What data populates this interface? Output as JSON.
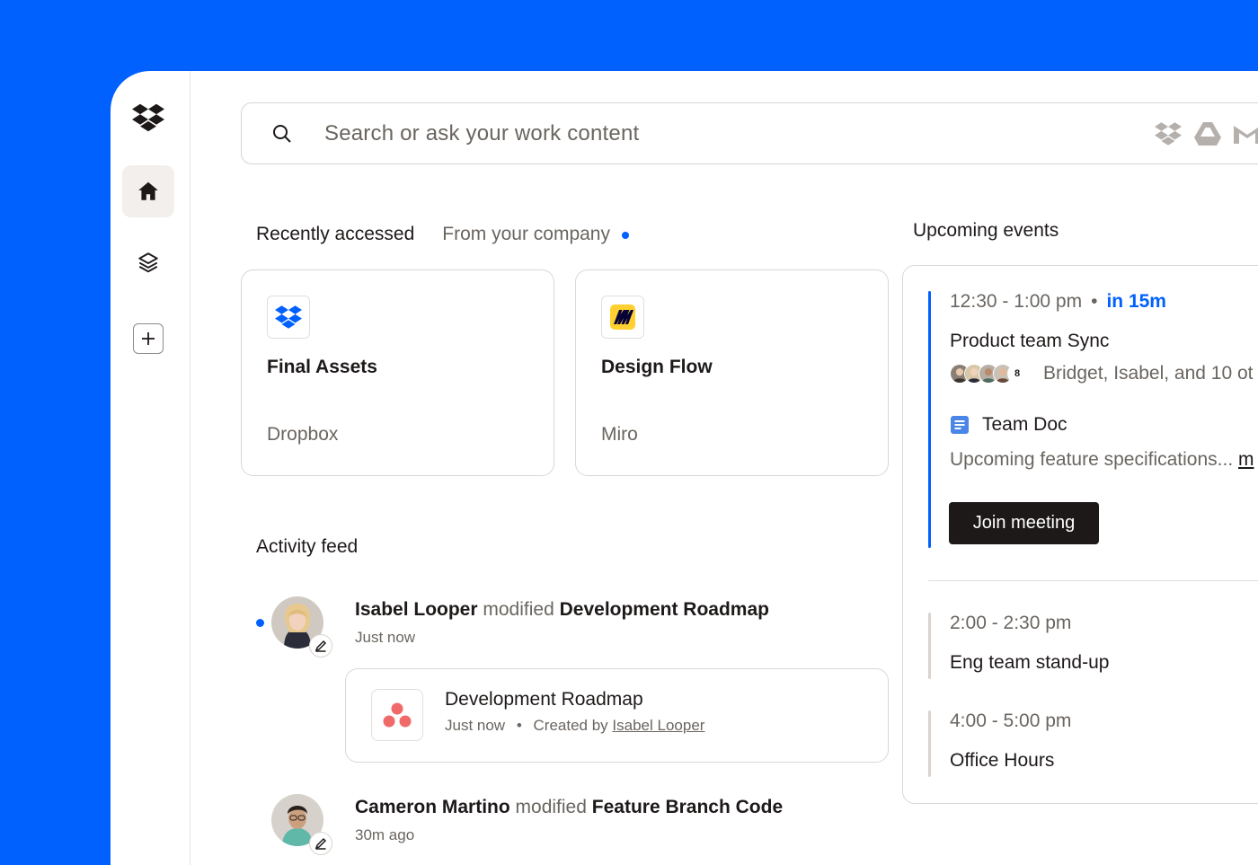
{
  "search": {
    "placeholder": "Search or ask your work content",
    "sources": [
      "dropbox-icon",
      "google-drive-icon",
      "gmail-icon"
    ]
  },
  "sidebar": {
    "items": [
      {
        "name": "home",
        "icon": "home-icon"
      },
      {
        "name": "layers",
        "icon": "layers-icon"
      },
      {
        "name": "add",
        "icon": "plus-icon"
      }
    ]
  },
  "tabs": {
    "recent": "Recently accessed",
    "company": "From your company"
  },
  "cards": [
    {
      "title": "Final Assets",
      "source": "Dropbox",
      "icon": "dropbox-icon"
    },
    {
      "title": "Design Flow",
      "source": "Miro",
      "icon": "miro-icon"
    }
  ],
  "activity": {
    "title": "Activity feed",
    "items": [
      {
        "who": "Isabel Looper",
        "verb": "modified",
        "what": "Development Roadmap",
        "time": "Just now",
        "unread": true,
        "file": {
          "title": "Development Roadmap",
          "time": "Just now",
          "sep": "•",
          "created_prefix": "Created by",
          "created_by": "Isabel Looper",
          "icon": "asana-icon"
        }
      },
      {
        "who": "Cameron Martino",
        "verb": "modified",
        "what": "Feature Branch Code",
        "time": "30m ago",
        "unread": false
      }
    ]
  },
  "events": {
    "title": "Upcoming events",
    "items": [
      {
        "time": "12:30 - 1:00 pm",
        "sep": "•",
        "soon": "in 15m",
        "title": "Product team Sync",
        "attendee_extra": "8",
        "attendees": "Bridget, Isabel, and 10 ot",
        "doc": "Team Doc",
        "desc": "Upcoming feature specifications... ",
        "desc_more": "m",
        "join": "Join meeting"
      },
      {
        "time": "2:00 - 2:30 pm",
        "title": "Eng team stand-up"
      },
      {
        "time": "4:00 - 5:00 pm",
        "title": "Office Hours"
      }
    ]
  },
  "colors": {
    "brand": "#0061FE",
    "text": "#1e1919",
    "muted": "#6a6560"
  }
}
